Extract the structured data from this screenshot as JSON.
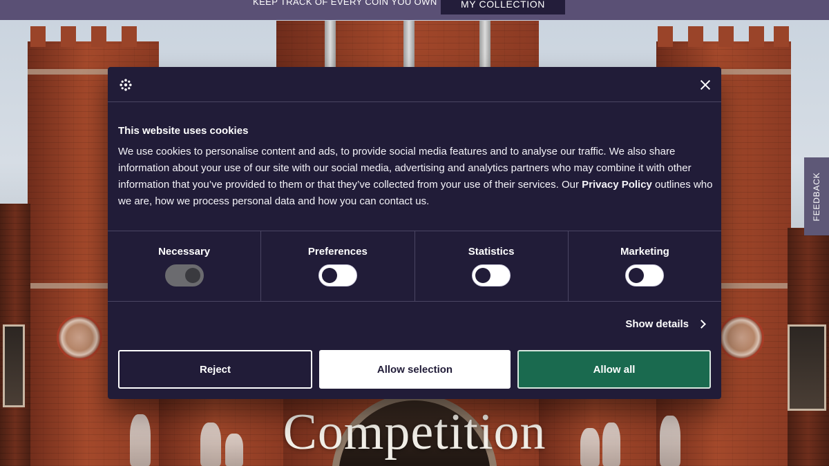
{
  "topbar": {
    "tagline": "KEEP TRACK OF EVERY COIN YOU OWN",
    "collection_button": "MY COLLECTION"
  },
  "feedback_tab": {
    "label": "FEEDBACK"
  },
  "hero": {
    "title": "Competition"
  },
  "cookie_dialog": {
    "title": "This website uses cookies",
    "body_text": "We use cookies to personalise content and ads, to provide social media features and to analyse our traffic. We also share information about your use of our site with our social media, advertising and analytics partners who may combine it with other information that you’ve provided to them or that they’ve collected from your use of their services. Our ",
    "privacy_link": "Privacy Policy",
    "body_text_end": " outlines who we are, how we process personal data and how you can contact us.",
    "categories": [
      {
        "label": "Necessary",
        "state": "on-locked"
      },
      {
        "label": "Preferences",
        "state": "off"
      },
      {
        "label": "Statistics",
        "state": "off"
      },
      {
        "label": "Marketing",
        "state": "off"
      }
    ],
    "show_details": "Show details",
    "buttons": {
      "reject": "Reject",
      "allow_selection": "Allow selection",
      "allow_all": "Allow all"
    },
    "colors": {
      "background": "#211c38",
      "allow_all": "#1a6a4f"
    }
  }
}
